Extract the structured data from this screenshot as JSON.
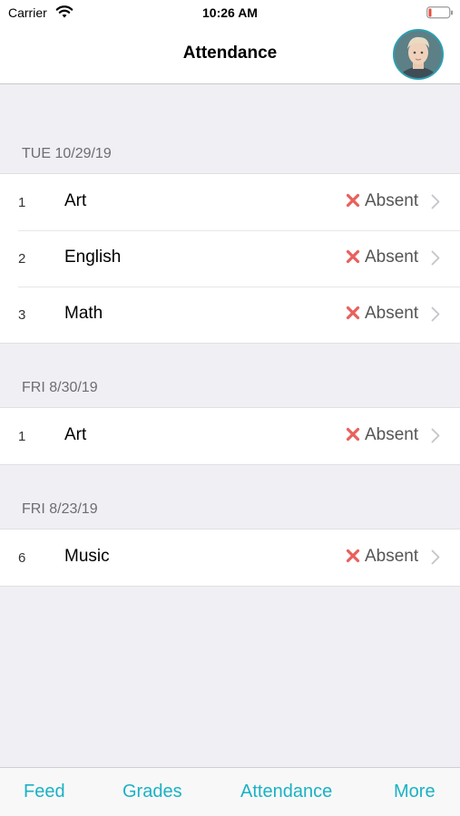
{
  "status_bar": {
    "carrier": "Carrier",
    "time": "10:26 AM",
    "battery_color": "#e74c3c"
  },
  "nav": {
    "title": "Attendance"
  },
  "sections": [
    {
      "date": "TUE 10/29/19",
      "rows": [
        {
          "period": "1",
          "subject": "Art",
          "status": "Absent"
        },
        {
          "period": "2",
          "subject": "English",
          "status": "Absent"
        },
        {
          "period": "3",
          "subject": "Math",
          "status": "Absent"
        }
      ]
    },
    {
      "date": "FRI 8/30/19",
      "rows": [
        {
          "period": "1",
          "subject": "Art",
          "status": "Absent"
        }
      ]
    },
    {
      "date": "FRI 8/23/19",
      "rows": [
        {
          "period": "6",
          "subject": "Music",
          "status": "Absent"
        }
      ]
    }
  ],
  "tabs": [
    {
      "label": "Feed"
    },
    {
      "label": "Grades"
    },
    {
      "label": "Attendance"
    },
    {
      "label": "More"
    }
  ],
  "colors": {
    "accent": "#1ab2c4",
    "absent_x": "#e8605c"
  }
}
